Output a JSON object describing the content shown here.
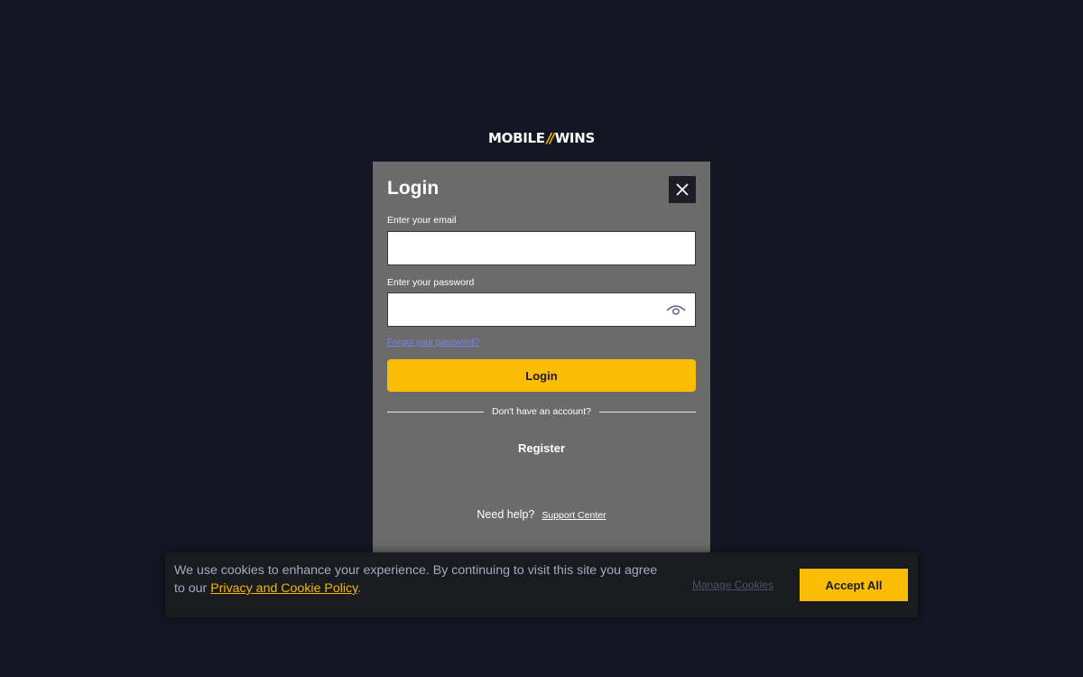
{
  "logo": {
    "left": "MOBILE",
    "separator": "//",
    "right": "WINS"
  },
  "modal": {
    "title": "Login",
    "close_icon": "close-icon",
    "email": {
      "label": "Enter your email",
      "value": "",
      "placeholder": ""
    },
    "password": {
      "label": "Enter your password",
      "value": "",
      "placeholder": "",
      "toggle_icon": "eye-icon"
    },
    "forgot_password": "Forgot your password?",
    "login_button": "Login",
    "divider_text": "Don't have an account?",
    "register": "Register",
    "help_text": "Need help?",
    "support_link": "Support Center"
  },
  "cookie_banner": {
    "text_before_link": "We use cookies to enhance your experience. By continuing to visit this site you agree to our ",
    "policy_link": "Privacy and Cookie Policy",
    "text_after_link": ".",
    "manage_cookies": "Manage Cookies",
    "accept_all": "Accept All"
  },
  "colors": {
    "background": "#141624",
    "modal": "#6b6b6b",
    "accent": "#fbbd04",
    "link": "#7b84e6"
  }
}
